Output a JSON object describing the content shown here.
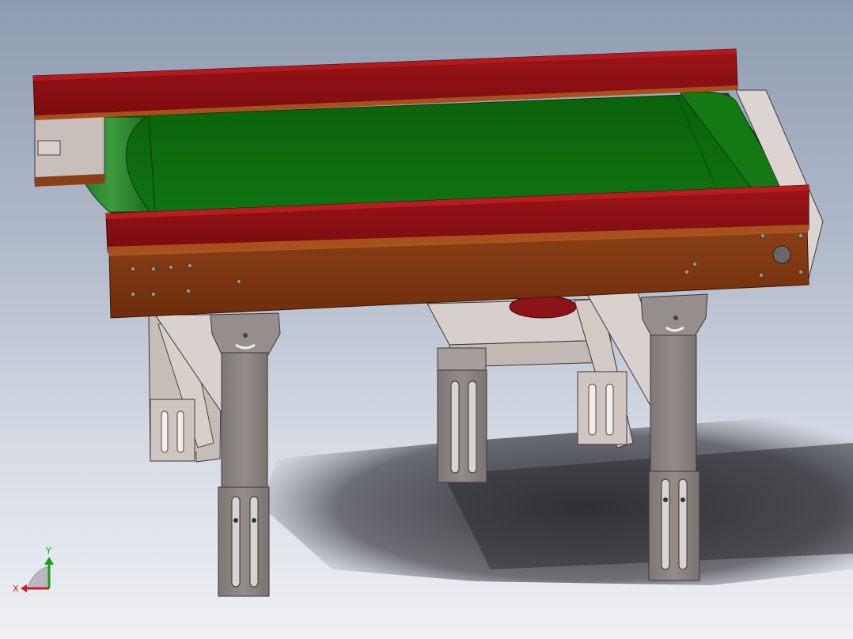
{
  "viewport": {
    "background_top": "#8e9bb0",
    "background_bottom": "#eef0f4"
  },
  "model": {
    "belt_color": "#0c6a0c",
    "side_guide_color": "#8c0f12",
    "frame_color": "#7a3410",
    "leg_color": "#8f8885",
    "bracket_color": "#d8cfcb",
    "shadow_color": "#2c2e33"
  },
  "triad": {
    "x_label": "X",
    "y_label": "Y",
    "x_color": "#c8202a",
    "y_color": "#18a018"
  }
}
